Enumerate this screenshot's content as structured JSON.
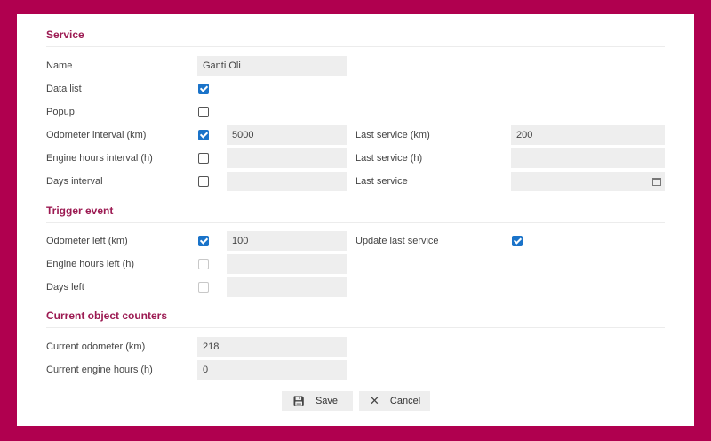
{
  "sections": {
    "service": "Service",
    "trigger": "Trigger event",
    "counters": "Current object counters"
  },
  "service": {
    "name_label": "Name",
    "name_value": "Ganti Oli",
    "data_list_label": "Data list",
    "data_list_checked": true,
    "popup_label": "Popup",
    "popup_checked": false,
    "odometer_interval_label": "Odometer interval (km)",
    "odometer_interval_checked": true,
    "odometer_interval_value": "5000",
    "engine_hours_interval_label": "Engine hours interval (h)",
    "engine_hours_interval_checked": false,
    "engine_hours_interval_value": "",
    "days_interval_label": "Days interval",
    "days_interval_checked": false,
    "days_interval_value": "",
    "last_service_km_label": "Last service (km)",
    "last_service_km_value": "200",
    "last_service_h_label": "Last service (h)",
    "last_service_h_value": "",
    "last_service_label": "Last service",
    "last_service_value": "",
    "calendar_icon": "calendar-icon"
  },
  "trigger": {
    "odometer_left_label": "Odometer left (km)",
    "odometer_left_checked": true,
    "odometer_left_value": "100",
    "engine_hours_left_label": "Engine hours left (h)",
    "engine_hours_left_checked": false,
    "engine_hours_left_value": "",
    "days_left_label": "Days left",
    "days_left_checked": false,
    "days_left_value": "",
    "update_last_service_label": "Update last service",
    "update_last_service_checked": true
  },
  "counters": {
    "current_odometer_label": "Current odometer (km)",
    "current_odometer_value": "218",
    "current_engine_hours_label": "Current engine hours (h)",
    "current_engine_hours_value": "0"
  },
  "buttons": {
    "save_label": "Save",
    "cancel_label": "Cancel",
    "save_icon": "save-icon",
    "cancel_icon": "close-icon"
  },
  "colors": {
    "frame": "#b0004f",
    "section_title": "#9c1a52",
    "checkbox_checked": "#1a73c9",
    "field_bg": "#eeeeee"
  }
}
